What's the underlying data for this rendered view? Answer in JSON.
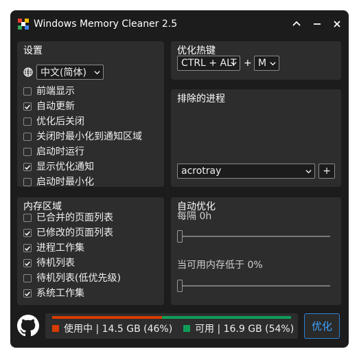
{
  "window": {
    "title": "Windows Memory Cleaner 2.5",
    "icons": [
      "app-icon",
      "collapse-icon",
      "minimize-icon",
      "close-icon"
    ]
  },
  "settings": {
    "title": "设置",
    "language": "中文(简体)",
    "options": [
      {
        "label": "前端显示",
        "checked": false
      },
      {
        "label": "自动更新",
        "checked": true
      },
      {
        "label": "优化后关闭",
        "checked": false
      },
      {
        "label": "关闭时最小化到通知区域",
        "checked": false
      },
      {
        "label": "启动时运行",
        "checked": false
      },
      {
        "label": "显示优化通知",
        "checked": true
      },
      {
        "label": "启动时最小化",
        "checked": false
      }
    ]
  },
  "hotkey": {
    "title": "优化热键",
    "modifier": "CTRL + ALT",
    "plus": "+",
    "key": "M"
  },
  "exclusions": {
    "title": "排除的进程",
    "process": "acrotray",
    "add_label": "+"
  },
  "memory_areas": {
    "title": "内存区域",
    "options": [
      {
        "label": "已合并的页面列表",
        "checked": false
      },
      {
        "label": "已修改的页面列表",
        "checked": true
      },
      {
        "label": "进程工作集",
        "checked": true
      },
      {
        "label": "待机列表",
        "checked": true
      },
      {
        "label": "待机列表(低优先级)",
        "checked": false
      },
      {
        "label": "系统工作集",
        "checked": true
      }
    ]
  },
  "auto_optimize": {
    "title": "自动优化",
    "interval_label": "每隔 0h",
    "interval_value": 0,
    "threshold_label": "当可用内存低于 0%",
    "threshold_value": 0
  },
  "memory": {
    "used_label": "使用中 | 14.5 GB (46%)",
    "free_label": "可用 | 16.9 GB (54%)",
    "used_fraction": 0.46,
    "free_fraction": 0.54,
    "used_color": "#d83b01",
    "free_color": "#0f9d58"
  },
  "optimize_button": "优化",
  "colors": {
    "background": "#1c1c1c",
    "panel": "#2d2d2d",
    "accent": "#3da2ff"
  }
}
